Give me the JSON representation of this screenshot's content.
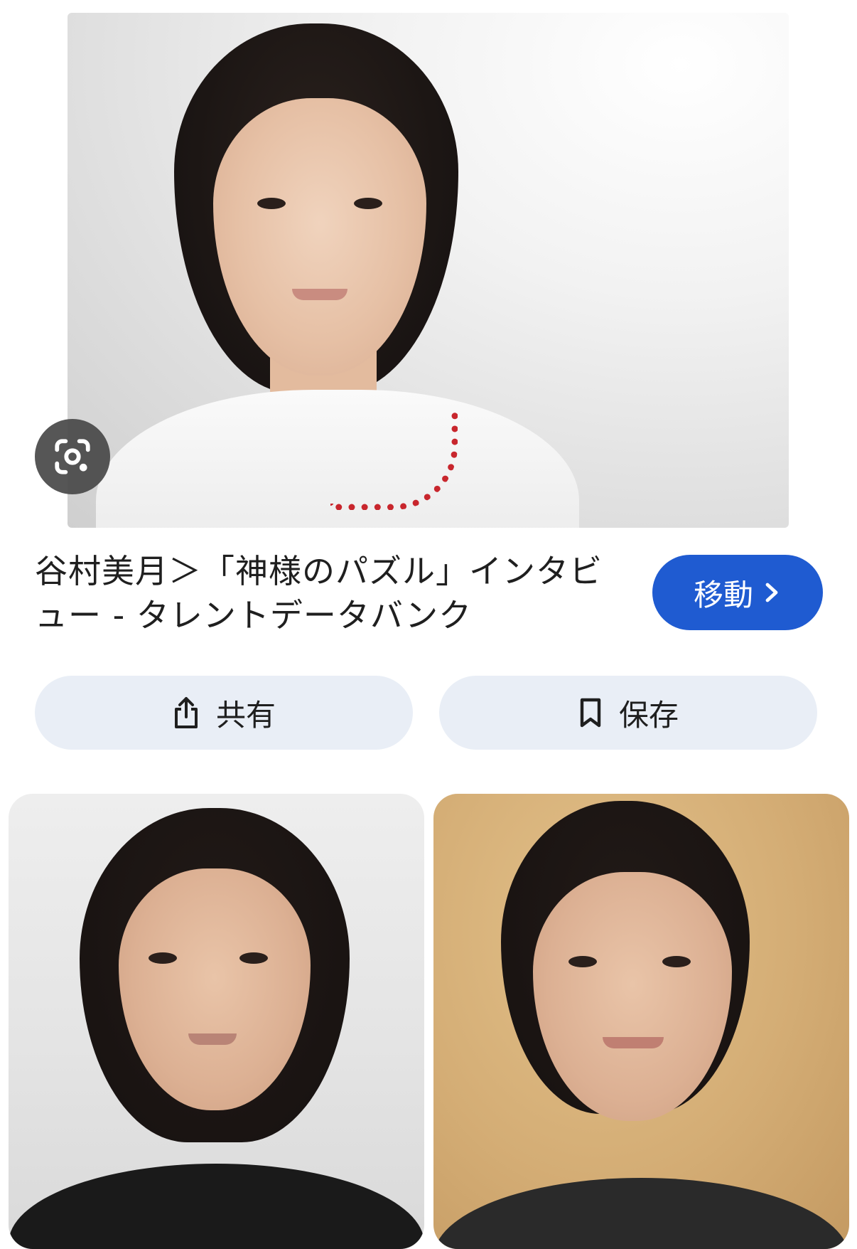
{
  "main_image": {
    "alt": "谷村美月＞「神様のパズル」インタビュー - タレントデータバンク"
  },
  "lens": {
    "icon": "google-lens-icon"
  },
  "result": {
    "title_line1": "谷村美月＞「神様のパズル」インタビ",
    "title_line2": "ュー - タレントデータバンク",
    "visit_label": "移動",
    "visit_icon": "chevron-right-icon",
    "visit_color": "#1f5bd1"
  },
  "actions": {
    "share_label": "共有",
    "share_icon": "share-icon",
    "save_label": "保存",
    "save_icon": "bookmark-icon",
    "pill_color": "#e9eef6"
  },
  "related": [
    {
      "kind": "image-thumbnail"
    },
    {
      "kind": "image-thumbnail"
    }
  ]
}
